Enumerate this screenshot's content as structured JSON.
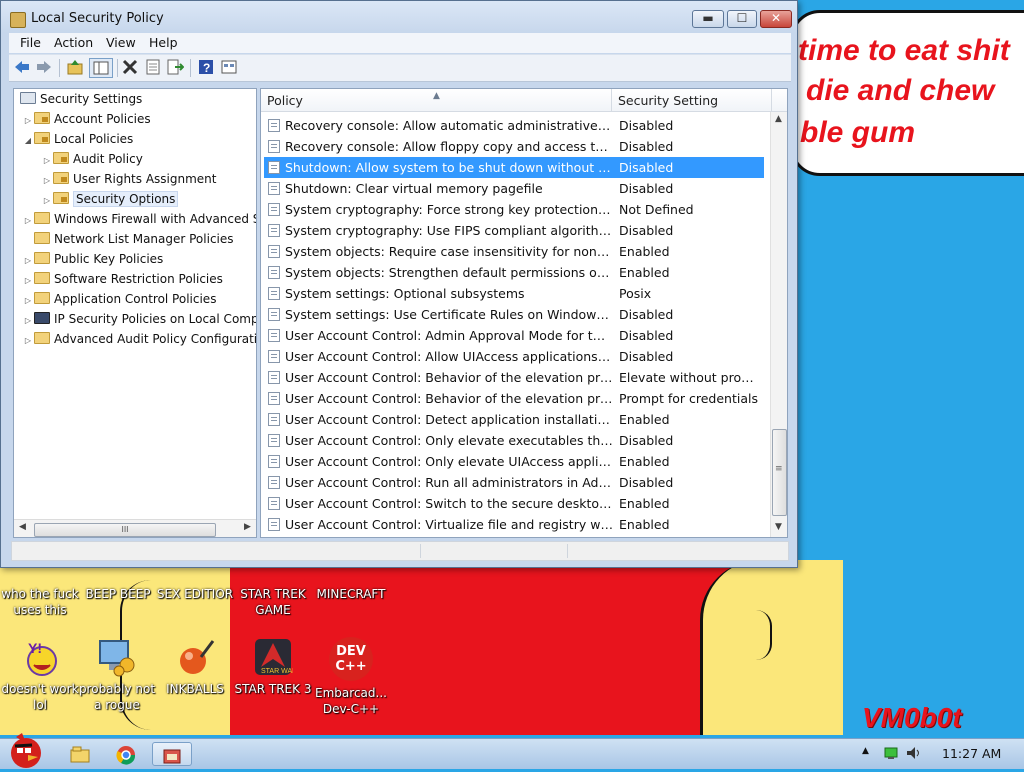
{
  "window": {
    "title": "Local Security Policy",
    "controls": {
      "minimize": "▬",
      "maximize": "☐",
      "close": "✕"
    }
  },
  "menu": [
    "File",
    "Action",
    "View",
    "Help"
  ],
  "toolbar_icons": [
    "back-arrow-icon",
    "forward-arrow-icon",
    "up-folder-icon",
    "show-hide-tree-icon",
    "delete-icon",
    "properties-icon",
    "export-list-icon",
    "help-icon",
    "details-view-icon"
  ],
  "tree": {
    "items": [
      {
        "label": "Security Settings",
        "indent": 0,
        "expander": "",
        "icon": "security-settings-icon"
      },
      {
        "label": "Account Policies",
        "indent": 1,
        "expander": "▷",
        "icon": "folder-lock-icon"
      },
      {
        "label": "Local Policies",
        "indent": 1,
        "expander": "◢",
        "icon": "folder-lock-icon"
      },
      {
        "label": "Audit Policy",
        "indent": 2,
        "expander": "▷",
        "icon": "folder-lock-icon"
      },
      {
        "label": "User Rights Assignment",
        "indent": 2,
        "expander": "▷",
        "icon": "folder-lock-icon"
      },
      {
        "label": "Security Options",
        "indent": 2,
        "expander": "▷",
        "icon": "folder-lock-icon",
        "selected": true
      },
      {
        "label": "Windows Firewall with Advanced Se",
        "indent": 1,
        "expander": "▷",
        "icon": "folder-icon"
      },
      {
        "label": "Network List Manager Policies",
        "indent": 1,
        "expander": "",
        "icon": "folder-icon"
      },
      {
        "label": "Public Key Policies",
        "indent": 1,
        "expander": "▷",
        "icon": "folder-icon"
      },
      {
        "label": "Software Restriction Policies",
        "indent": 1,
        "expander": "▷",
        "icon": "folder-icon"
      },
      {
        "label": "Application Control Policies",
        "indent": 1,
        "expander": "▷",
        "icon": "folder-icon"
      },
      {
        "label": "IP Security Policies on Local Compu",
        "indent": 1,
        "expander": "▷",
        "icon": "ip-security-icon"
      },
      {
        "label": "Advanced Audit Policy Configuration",
        "indent": 1,
        "expander": "▷",
        "icon": "folder-icon"
      }
    ],
    "hscroll_grip": "III"
  },
  "list": {
    "columns": {
      "policy": "Policy",
      "setting": "Security Setting"
    },
    "sort_indicator": "▲",
    "rows": [
      {
        "policy": "Recovery console: Allow automatic administrative logon",
        "setting": "Disabled"
      },
      {
        "policy": "Recovery console: Allow floppy copy and access to all...",
        "setting": "Disabled"
      },
      {
        "policy": "Shutdown: Allow system to be shut down without havi...",
        "setting": "Disabled",
        "selected": true
      },
      {
        "policy": "Shutdown: Clear virtual memory pagefile",
        "setting": "Disabled"
      },
      {
        "policy": "System cryptography: Force strong key protection for ...",
        "setting": "Not Defined"
      },
      {
        "policy": "System cryptography: Use FIPS compliant algorithms f...",
        "setting": "Disabled"
      },
      {
        "policy": "System objects: Require case insensitivity for non-Win...",
        "setting": "Enabled"
      },
      {
        "policy": "System objects: Strengthen default permissions of inte...",
        "setting": "Enabled"
      },
      {
        "policy": "System settings: Optional subsystems",
        "setting": "Posix"
      },
      {
        "policy": "System settings: Use Certificate Rules on Windows Exe...",
        "setting": "Disabled"
      },
      {
        "policy": "User Account Control: Admin Approval Mode for the ...",
        "setting": "Disabled"
      },
      {
        "policy": "User Account Control: Allow UIAccess applications to ...",
        "setting": "Disabled"
      },
      {
        "policy": "User Account Control: Behavior of the elevation prom...",
        "setting": "Elevate without prom..."
      },
      {
        "policy": "User Account Control: Behavior of the elevation prom...",
        "setting": "Prompt for credentials"
      },
      {
        "policy": "User Account Control: Detect application installations ...",
        "setting": "Enabled"
      },
      {
        "policy": "User Account Control: Only elevate executables that ar...",
        "setting": "Disabled"
      },
      {
        "policy": "User Account Control: Only elevate UIAccess applicati...",
        "setting": "Enabled"
      },
      {
        "policy": "User Account Control: Run all administrators in Admin ...",
        "setting": "Disabled"
      },
      {
        "policy": "User Account Control: Switch to the secure desktop w...",
        "setting": "Enabled"
      },
      {
        "policy": "User Account Control: Virtualize file and registry write ...",
        "setting": "Enabled"
      }
    ],
    "vscroll_grip": "≡"
  },
  "wallpaper": {
    "speech_lines": [
      "time to eat shit",
      "die and chew",
      "ble gum"
    ],
    "watermark": "VM0b0t"
  },
  "desktop_icons": [
    {
      "label": "who the fuck uses this",
      "icon": "partial-icon"
    },
    {
      "label": "BEEP BEEP",
      "icon": "partial-icon"
    },
    {
      "label": "SEX EDITIOR",
      "icon": "partial-icon"
    },
    {
      "label": "STAR TREK GAME",
      "icon": "partial-icon"
    },
    {
      "label": "MINECRAFT",
      "icon": "partial-icon"
    },
    {
      "label": "doesn't work lol",
      "icon": "yahoo-messenger-icon"
    },
    {
      "label": "probably not a rogue",
      "icon": "monitor-gears-icon"
    },
    {
      "label": "INKBALLS",
      "icon": "inkball-icon"
    },
    {
      "label": "STAR TREK 3",
      "icon": "star-trek-icon"
    },
    {
      "label": "Embarcad... Dev-C++",
      "icon": "dev-cpp-icon"
    }
  ],
  "dev_icon_text": "DEV C++",
  "taskbar": {
    "start_icon": "angry-bird-start-icon",
    "pinned": [
      "folder-icon",
      "chrome-icon",
      "local-security-policy-icon"
    ],
    "tray_up": "▲",
    "clock": "11:27 AM"
  },
  "colors": {
    "selection": "#3399ff",
    "wallpaper_blue": "#2aa6e6",
    "wallpaper_red": "#e8141d",
    "wallpaper_yellow": "#fbe77a"
  }
}
